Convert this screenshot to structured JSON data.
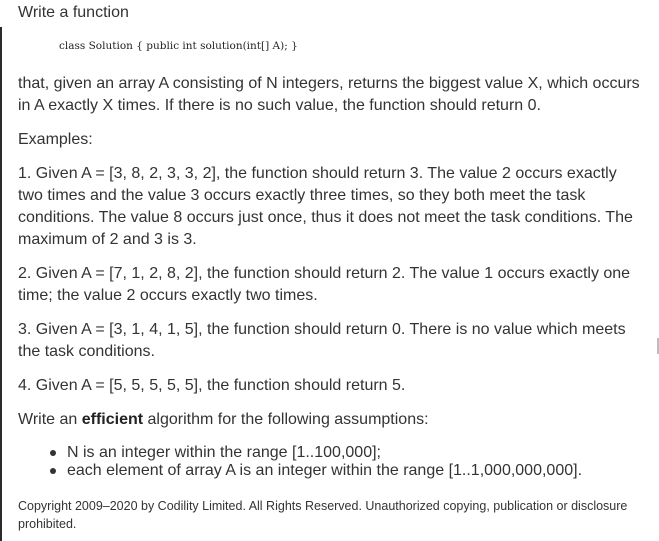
{
  "intro": "Write a function",
  "code_signature": "class Solution { public int solution(int[] A); }",
  "description": "that, given an array A consisting of N integers, returns the biggest value X, which occurs in A exactly X times. If there is no such value, the function should return 0.",
  "examples_heading": "Examples:",
  "examples": [
    "1. Given A = [3, 8, 2, 3, 3, 2], the function should return 3. The value 2 occurs exactly two times and the value 3 occurs exactly three times, so they both meet the task conditions. The value 8 occurs just once, thus it does not meet the task conditions. The maximum of 2 and 3 is 3.",
    "2. Given A = [7, 1, 2, 8, 2], the function should return 2. The value 1 occurs exactly one time; the value 2 occurs exactly two times.",
    "3. Given A = [3, 1, 4, 1, 5], the function should return 0. There is no value which meets the task conditions.",
    "4. Given A = [5, 5, 5, 5, 5], the function should return 5."
  ],
  "assumptions_intro": {
    "before": "Write an ",
    "emphasis": "efficient",
    "after": " algorithm for the following assumptions:"
  },
  "assumptions": [
    "N is an integer within the range [1..100,000];",
    "each element of array A is an integer within the range [1..1,000,000,000]."
  ],
  "copyright": "Copyright 2009–2020 by Codility Limited. All Rights Reserved. Unauthorized copying, publication or disclosure prohibited."
}
